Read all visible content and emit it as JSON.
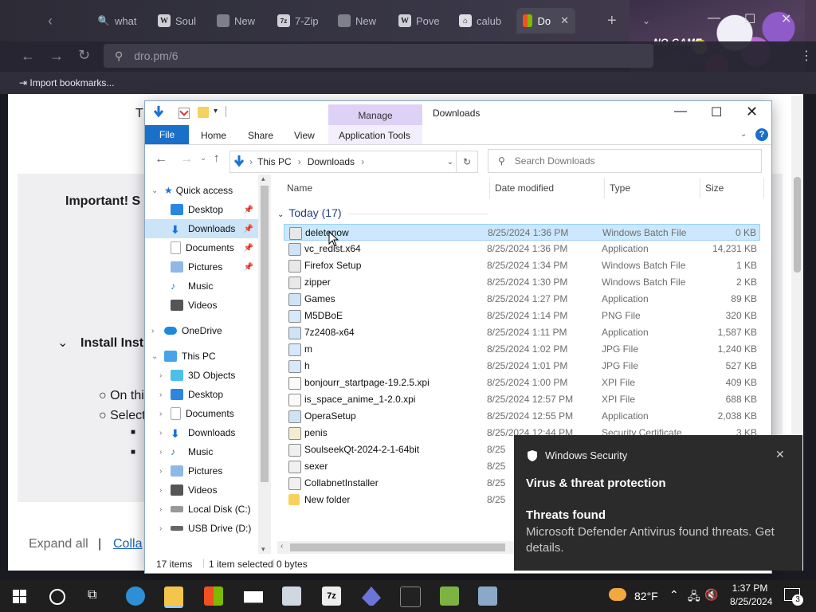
{
  "browser": {
    "tabs": [
      {
        "label": "what",
        "icon": "search-icon"
      },
      {
        "label": "Soul",
        "icon": "W"
      },
      {
        "label": "New",
        "icon": "image-icon"
      },
      {
        "label": "7-Zip",
        "icon": "7z"
      },
      {
        "label": "New",
        "icon": "image-icon"
      },
      {
        "label": "Pove",
        "icon": "W"
      },
      {
        "label": "calub",
        "icon": "bank-icon"
      },
      {
        "label": "Do",
        "icon": "windows-icon"
      }
    ],
    "address": "dro.pm/6",
    "bookmarks_import": "Import bookmarks...",
    "banner_text": "NO GAME"
  },
  "page_under": {
    "heading_fragment": "T",
    "important": "Important! S",
    "install": "Install Instr",
    "bullet1": "On thi",
    "bullet2": "Select",
    "expand_all": "Expand all",
    "separator": "|",
    "collapse": "Colla"
  },
  "explorer": {
    "title": "Downloads",
    "manage": "Manage",
    "tabs": [
      "File",
      "Home",
      "Share",
      "View"
    ],
    "app_tools": "Application Tools",
    "breadcrumb": [
      "This PC",
      "Downloads"
    ],
    "search_placeholder": "Search Downloads",
    "nav": {
      "quick_access": "Quick access",
      "qa_items": [
        "Desktop",
        "Downloads",
        "Documents",
        "Pictures",
        "Music",
        "Videos"
      ],
      "onedrive": "OneDrive",
      "this_pc": "This PC",
      "pc_items": [
        "3D Objects",
        "Desktop",
        "Documents",
        "Downloads",
        "Music",
        "Pictures",
        "Videos",
        "Local Disk (C:)",
        "USB Drive (D:)"
      ]
    },
    "columns": [
      "Name",
      "Date modified",
      "Type",
      "Size"
    ],
    "group": "Today (17)",
    "files": [
      {
        "name": "deletenow",
        "date": "8/25/2024 1:36 PM",
        "type": "Windows Batch File",
        "size": "0 KB"
      },
      {
        "name": "vc_redist.x64",
        "date": "8/25/2024 1:36 PM",
        "type": "Application",
        "size": "14,231 KB"
      },
      {
        "name": "Firefox Setup",
        "date": "8/25/2024 1:34 PM",
        "type": "Windows Batch File",
        "size": "1 KB"
      },
      {
        "name": "zipper",
        "date": "8/25/2024 1:30 PM",
        "type": "Windows Batch File",
        "size": "2 KB"
      },
      {
        "name": "Games",
        "date": "8/25/2024 1:27 PM",
        "type": "Application",
        "size": "89 KB"
      },
      {
        "name": "M5DBoE",
        "date": "8/25/2024 1:14 PM",
        "type": "PNG File",
        "size": "320 KB"
      },
      {
        "name": "7z2408-x64",
        "date": "8/25/2024 1:11 PM",
        "type": "Application",
        "size": "1,587 KB"
      },
      {
        "name": "m",
        "date": "8/25/2024 1:02 PM",
        "type": "JPG File",
        "size": "1,240 KB"
      },
      {
        "name": "h",
        "date": "8/25/2024 1:01 PM",
        "type": "JPG File",
        "size": "527 KB"
      },
      {
        "name": "bonjourr_startpage-19.2.5.xpi",
        "date": "8/25/2024 1:00 PM",
        "type": "XPI File",
        "size": "409 KB"
      },
      {
        "name": "is_space_anime_1-2.0.xpi",
        "date": "8/25/2024 12:57 PM",
        "type": "XPI File",
        "size": "688 KB"
      },
      {
        "name": "OperaSetup",
        "date": "8/25/2024 12:55 PM",
        "type": "Application",
        "size": "2,038 KB"
      },
      {
        "name": "penis",
        "date": "8/25/2024 12:44 PM",
        "type": "Security Certificate",
        "size": "3 KB"
      },
      {
        "name": "SoulseekQt-2024-2-1-64bit",
        "date": "8/25",
        "type": "",
        "size": ""
      },
      {
        "name": "sexer",
        "date": "8/25",
        "type": "",
        "size": ""
      },
      {
        "name": "CollabnetInstaller",
        "date": "8/25",
        "type": "",
        "size": ""
      },
      {
        "name": "New folder",
        "date": "8/25",
        "type": "",
        "size": ""
      }
    ],
    "status": {
      "count": "17 items",
      "selected": "1 item selected",
      "bytes": "0 bytes"
    }
  },
  "toast": {
    "app": "Windows Security",
    "heading": "Virus & threat protection",
    "title": "Threats found",
    "body": "Microsoft Defender Antivirus found threats. Get details."
  },
  "taskbar": {
    "weather": "82°F",
    "time": "1:37 PM",
    "date": "8/25/2024",
    "notifications": "3"
  }
}
